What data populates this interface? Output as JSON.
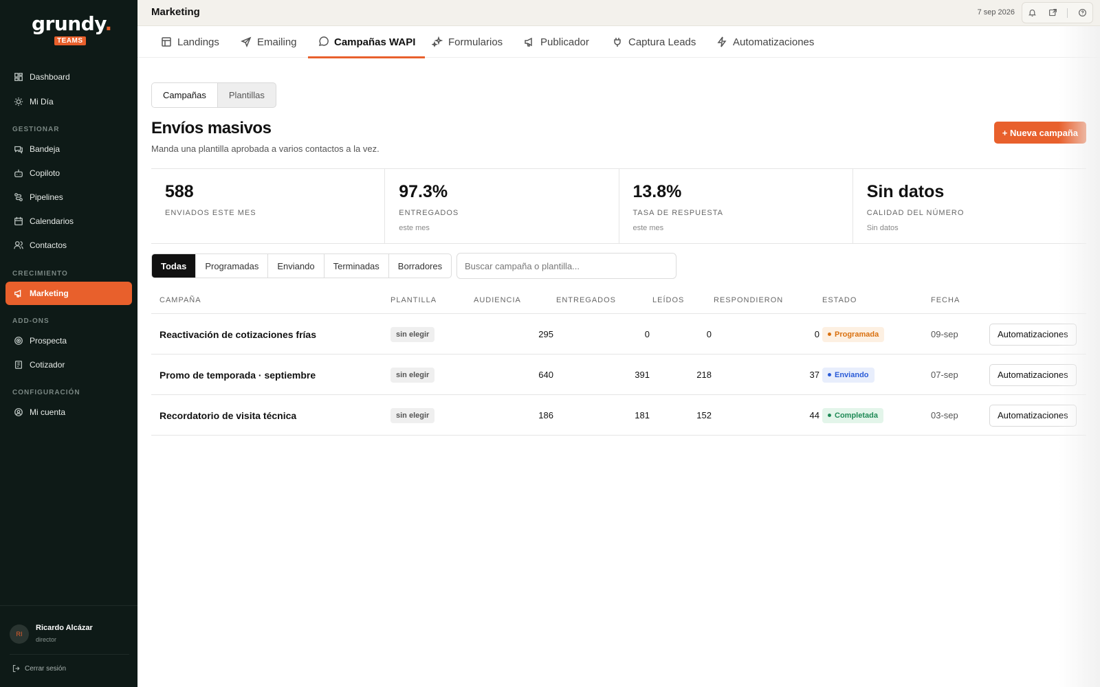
{
  "brand": {
    "name": "grundy",
    "dot": ".",
    "badge": "TEAMS"
  },
  "sidebar": {
    "items_top": [
      {
        "label": "Dashboard",
        "icon": "dashboard-icon"
      },
      {
        "label": "Mi Día",
        "icon": "sun-icon"
      }
    ],
    "section_manage": "GESTIONAR",
    "items_manage": [
      {
        "label": "Bandeja",
        "icon": "inbox-icon"
      },
      {
        "label": "Copiloto",
        "icon": "bot-icon"
      },
      {
        "label": "Pipelines",
        "icon": "pipeline-icon"
      },
      {
        "label": "Calendarios",
        "icon": "calendar-icon"
      },
      {
        "label": "Contactos",
        "icon": "contacts-icon"
      }
    ],
    "section_growth": "CRECIMIENTO",
    "items_growth": [
      {
        "label": "Marketing",
        "icon": "megaphone-icon",
        "active": true
      }
    ],
    "section_addons": "ADD-ONS",
    "items_addons": [
      {
        "label": "Prospecta",
        "icon": "target-icon"
      },
      {
        "label": "Cotizador",
        "icon": "document-icon"
      }
    ],
    "section_config": "CONFIGURACIÓN",
    "items_config": [
      {
        "label": "Mi cuenta",
        "icon": "user-circle-icon"
      }
    ],
    "user": {
      "initials": "RI",
      "name": "Ricardo Alcázar",
      "role": "director"
    },
    "logout": "Cerrar sesión"
  },
  "topbar": {
    "title": "Marketing",
    "date": "7 sep 2026"
  },
  "module_tabs": [
    {
      "label": "Landings",
      "icon": "layout-icon"
    },
    {
      "label": "Emailing",
      "icon": "send-icon"
    },
    {
      "label": "Campañas WAPI",
      "icon": "chat-icon",
      "active": true
    },
    {
      "label": "Formularios",
      "icon": "sparkles-icon"
    },
    {
      "label": "Publicador",
      "icon": "megaphone-icon"
    },
    {
      "label": "Captura Leads",
      "icon": "plug-icon"
    },
    {
      "label": "Automatizaciones",
      "icon": "bolt-icon"
    }
  ],
  "segment": {
    "campaigns": "Campañas",
    "templates": "Plantillas"
  },
  "page": {
    "title": "Envíos masivos",
    "subtitle": "Manda una plantilla aprobada a varios contactos a la vez.",
    "new_button": "+ Nueva campaña"
  },
  "stats": [
    {
      "value": "588",
      "label": "ENVIADOS ESTE MES",
      "note": ""
    },
    {
      "value": "97.3%",
      "label": "ENTREGADOS",
      "note": "este mes"
    },
    {
      "value": "13.8%",
      "label": "TASA DE RESPUESTA",
      "note": "este mes"
    },
    {
      "value": "Sin datos",
      "label": "CALIDAD DEL NÚMERO",
      "note": "Sin datos"
    }
  ],
  "filters": [
    "Todas",
    "Programadas",
    "Enviando",
    "Terminadas",
    "Borradores"
  ],
  "search": {
    "placeholder": "Buscar campaña o plantilla..."
  },
  "table": {
    "headers": {
      "campaign": "CAMPAÑA",
      "template": "PLANTILLA",
      "audience": "AUDIENCIA",
      "delivered": "ENTREGADOS",
      "read": "LEÍDOS",
      "replied": "RESPONDIERON",
      "status": "ESTADO",
      "date": "FECHA"
    },
    "rows": [
      {
        "name": "Reactivación de cotizaciones frías",
        "template": "sin elegir",
        "audience": "295",
        "delivered": "0",
        "read": "0",
        "replied": "0",
        "status": "Programada",
        "status_color": "#d9700f",
        "status_bg": "#fdf0e2",
        "date": "09-sep",
        "action": "Automatizaciones"
      },
      {
        "name": "Promo de temporada · septiembre",
        "template": "sin elegir",
        "audience": "640",
        "delivered": "391",
        "read": "218",
        "replied": "37",
        "status": "Enviando",
        "status_color": "#2a5bd7",
        "status_bg": "#e8eefc",
        "date": "07-sep",
        "action": "Automatizaciones"
      },
      {
        "name": "Recordatorio de visita técnica",
        "template": "sin elegir",
        "audience": "186",
        "delivered": "181",
        "read": "152",
        "replied": "44",
        "status": "Completada",
        "status_color": "#1f8a56",
        "status_bg": "#e3f5ea",
        "date": "03-sep",
        "action": "Automatizaciones"
      }
    ]
  },
  "colors": {
    "accent": "#e8602c",
    "sidebar_bg": "#0e1a17"
  }
}
